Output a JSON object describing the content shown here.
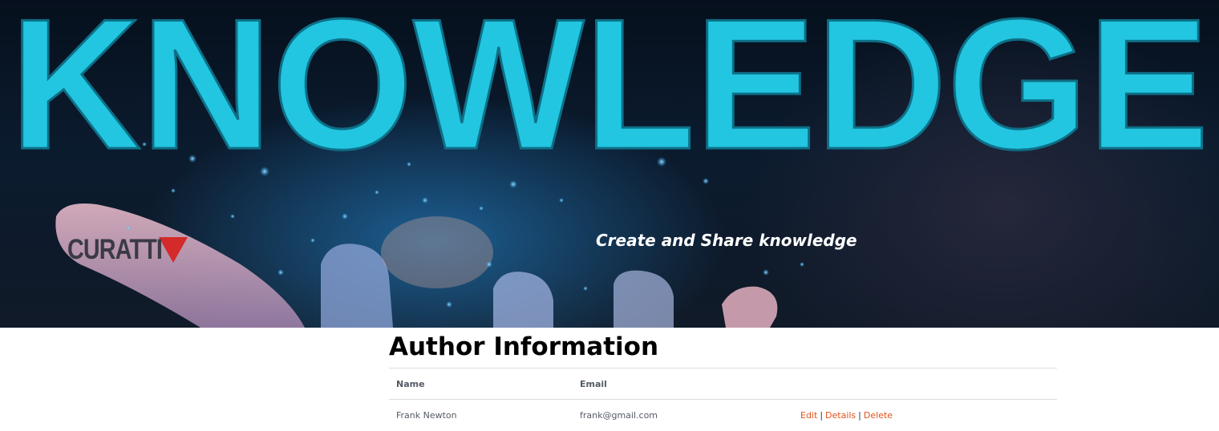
{
  "hero": {
    "headline": "KNOWLEDGE",
    "logo_text": "CURATTI",
    "tagline": "Create and Share knowledge",
    "colors": {
      "headline": "#22c6e0",
      "logo_mark": "#d42a2a"
    }
  },
  "main": {
    "title": "Author Information",
    "table": {
      "headers": [
        "Name",
        "Email",
        ""
      ],
      "rows": [
        {
          "name": "Frank Newton",
          "email": "frank@gmail.com",
          "actions": [
            "Edit",
            "Details",
            "Delete"
          ]
        }
      ]
    },
    "action_color": "#e0531a"
  }
}
